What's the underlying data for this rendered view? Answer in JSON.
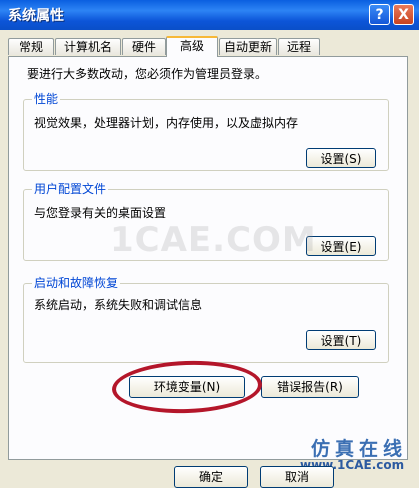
{
  "window": {
    "title": "系统属性",
    "help_button": "?",
    "close_button": "X"
  },
  "tabs": [
    {
      "label": "常规"
    },
    {
      "label": "计算机名"
    },
    {
      "label": "硬件"
    },
    {
      "label": "高级"
    },
    {
      "label": "自动更新"
    },
    {
      "label": "远程"
    }
  ],
  "active_tab": "高级",
  "intro": "要进行大多数改动，您必须作为管理员登录。",
  "groups": {
    "performance": {
      "title": "性能",
      "description": "视觉效果，处理器计划，内存使用，以及虚拟内存",
      "button": "设置(S)"
    },
    "user_profiles": {
      "title": "用户配置文件",
      "description": "与您登录有关的桌面设置",
      "button": "设置(E)"
    },
    "startup_recovery": {
      "title": "启动和故障恢复",
      "description": "系统启动，系统失败和调试信息",
      "button": "设置(T)"
    }
  },
  "buttons": {
    "env_vars": "环境变量(N)",
    "error_report": "错误报告(R)",
    "ok": "确定",
    "cancel": "取消"
  },
  "watermark": {
    "center": "1CAE.COM",
    "brand_cn": "仿真在线",
    "url": "www.1CAE.com"
  },
  "colors": {
    "title_bar": "#0a5fe0",
    "dialog_bg": "#ece9d8",
    "group_title": "#0046d5",
    "annotation_circle": "#b4162a"
  }
}
